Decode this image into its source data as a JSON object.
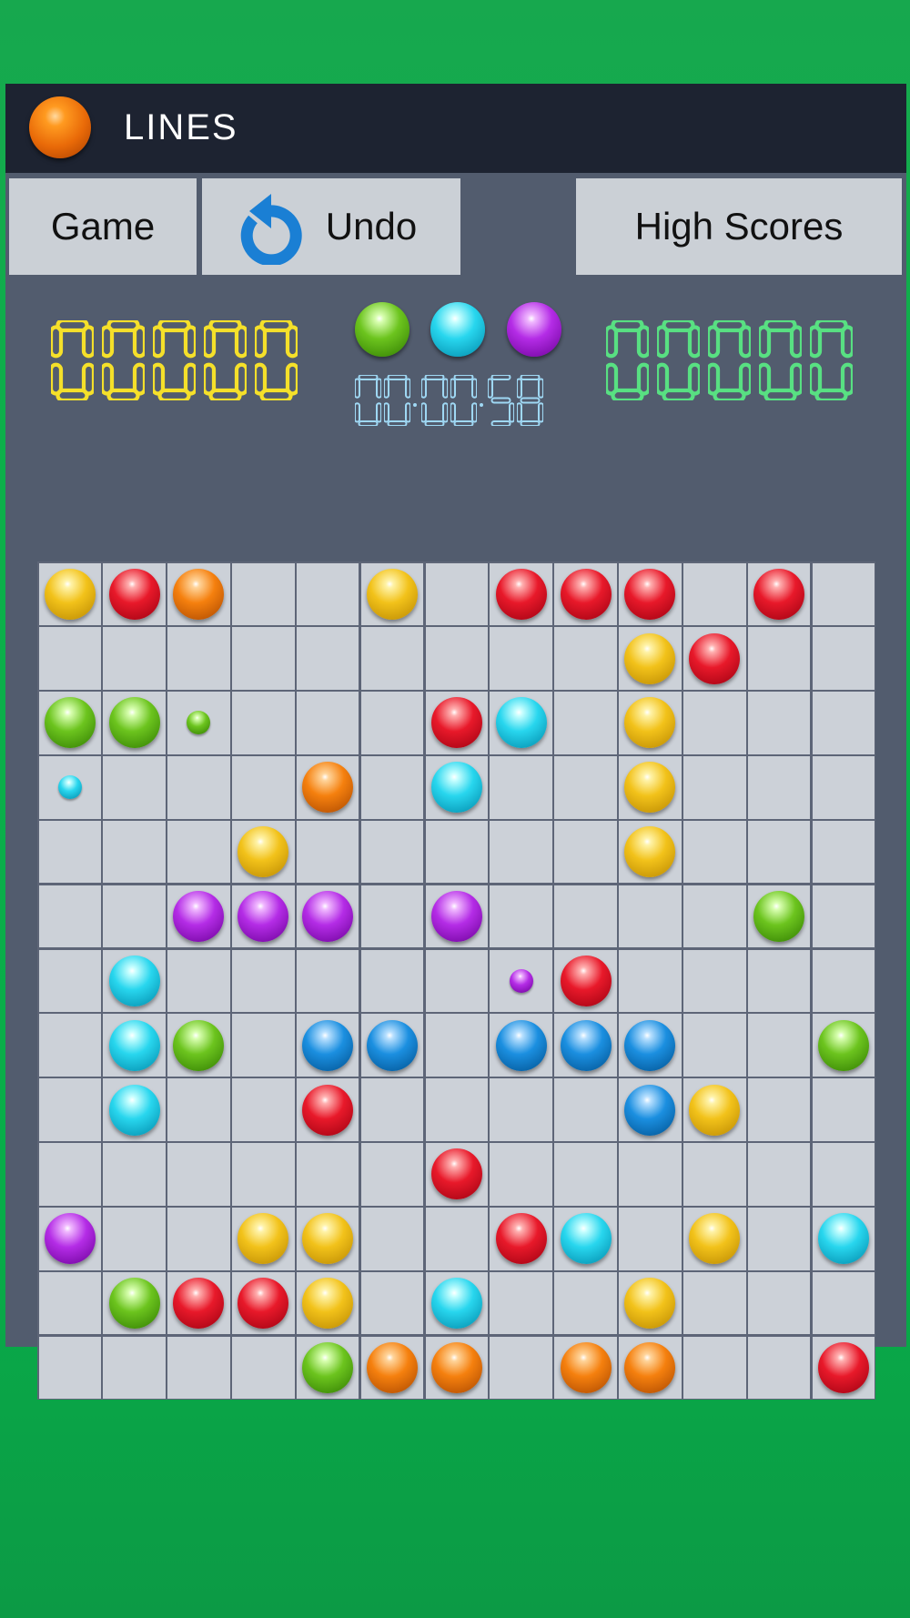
{
  "app": {
    "title": "LINES",
    "icon": "orange-ball-icon"
  },
  "toolbar": {
    "game_label": "Game",
    "undo_label": "Undo",
    "undo_icon": "undo-icon",
    "scores_label": "High Scores"
  },
  "score": {
    "current": "00000",
    "high": "00000"
  },
  "timer": "00:00:58",
  "next_balls": [
    "green",
    "cyan",
    "purple"
  ],
  "colors": {
    "yellow": [
      "#fff3a8",
      "#f2c21a",
      "#b88600"
    ],
    "red": [
      "#ffb0b0",
      "#e8192a",
      "#9b0010"
    ],
    "orange": [
      "#ffd49a",
      "#f5800e",
      "#a84600"
    ],
    "green": [
      "#d8ffb0",
      "#6cc41e",
      "#2f7a00"
    ],
    "cyan": [
      "#c8ffff",
      "#28d6ee",
      "#0088a8"
    ],
    "purple": [
      "#f0b8ff",
      "#b42ce6",
      "#6a0096"
    ],
    "blue": [
      "#b8e0ff",
      "#1b8fe0",
      "#00508e"
    ],
    "score_yellow": "#f5e02a",
    "score_green": "#58e082",
    "timer_blue": "#9fd8f4"
  },
  "board": {
    "rows": 13,
    "cols": 13,
    "balls": [
      {
        "r": 0,
        "c": 0,
        "color": "yellow"
      },
      {
        "r": 0,
        "c": 1,
        "color": "red"
      },
      {
        "r": 0,
        "c": 2,
        "color": "orange"
      },
      {
        "r": 0,
        "c": 5,
        "color": "yellow"
      },
      {
        "r": 0,
        "c": 7,
        "color": "red"
      },
      {
        "r": 0,
        "c": 8,
        "color": "red"
      },
      {
        "r": 0,
        "c": 9,
        "color": "red"
      },
      {
        "r": 0,
        "c": 11,
        "color": "red"
      },
      {
        "r": 1,
        "c": 9,
        "color": "yellow"
      },
      {
        "r": 1,
        "c": 10,
        "color": "red"
      },
      {
        "r": 2,
        "c": 0,
        "color": "green"
      },
      {
        "r": 2,
        "c": 1,
        "color": "green"
      },
      {
        "r": 2,
        "c": 2,
        "color": "green",
        "small": true
      },
      {
        "r": 2,
        "c": 6,
        "color": "red"
      },
      {
        "r": 2,
        "c": 7,
        "color": "cyan"
      },
      {
        "r": 2,
        "c": 9,
        "color": "yellow"
      },
      {
        "r": 3,
        "c": 0,
        "color": "cyan",
        "small": true
      },
      {
        "r": 3,
        "c": 4,
        "color": "orange"
      },
      {
        "r": 3,
        "c": 6,
        "color": "cyan"
      },
      {
        "r": 3,
        "c": 9,
        "color": "yellow"
      },
      {
        "r": 4,
        "c": 3,
        "color": "yellow"
      },
      {
        "r": 4,
        "c": 9,
        "color": "yellow"
      },
      {
        "r": 5,
        "c": 2,
        "color": "purple"
      },
      {
        "r": 5,
        "c": 3,
        "color": "purple"
      },
      {
        "r": 5,
        "c": 4,
        "color": "purple"
      },
      {
        "r": 5,
        "c": 6,
        "color": "purple"
      },
      {
        "r": 5,
        "c": 11,
        "color": "green"
      },
      {
        "r": 6,
        "c": 1,
        "color": "cyan"
      },
      {
        "r": 6,
        "c": 7,
        "color": "purple",
        "small": true
      },
      {
        "r": 6,
        "c": 8,
        "color": "red"
      },
      {
        "r": 7,
        "c": 1,
        "color": "cyan"
      },
      {
        "r": 7,
        "c": 2,
        "color": "green"
      },
      {
        "r": 7,
        "c": 4,
        "color": "blue"
      },
      {
        "r": 7,
        "c": 5,
        "color": "blue"
      },
      {
        "r": 7,
        "c": 7,
        "color": "blue"
      },
      {
        "r": 7,
        "c": 8,
        "color": "blue"
      },
      {
        "r": 7,
        "c": 9,
        "color": "blue"
      },
      {
        "r": 7,
        "c": 12,
        "color": "green"
      },
      {
        "r": 8,
        "c": 1,
        "color": "cyan"
      },
      {
        "r": 8,
        "c": 4,
        "color": "red"
      },
      {
        "r": 8,
        "c": 9,
        "color": "blue"
      },
      {
        "r": 8,
        "c": 10,
        "color": "yellow"
      },
      {
        "r": 9,
        "c": 6,
        "color": "red"
      },
      {
        "r": 10,
        "c": 0,
        "color": "purple"
      },
      {
        "r": 10,
        "c": 3,
        "color": "yellow"
      },
      {
        "r": 10,
        "c": 4,
        "color": "yellow"
      },
      {
        "r": 10,
        "c": 7,
        "color": "red"
      },
      {
        "r": 10,
        "c": 8,
        "color": "cyan"
      },
      {
        "r": 10,
        "c": 10,
        "color": "yellow"
      },
      {
        "r": 10,
        "c": 12,
        "color": "cyan"
      },
      {
        "r": 11,
        "c": 1,
        "color": "green"
      },
      {
        "r": 11,
        "c": 2,
        "color": "red"
      },
      {
        "r": 11,
        "c": 3,
        "color": "red"
      },
      {
        "r": 11,
        "c": 4,
        "color": "yellow"
      },
      {
        "r": 11,
        "c": 6,
        "color": "cyan"
      },
      {
        "r": 11,
        "c": 9,
        "color": "yellow"
      },
      {
        "r": 12,
        "c": 4,
        "color": "green"
      },
      {
        "r": 12,
        "c": 5,
        "color": "orange"
      },
      {
        "r": 12,
        "c": 6,
        "color": "orange"
      },
      {
        "r": 12,
        "c": 8,
        "color": "orange"
      },
      {
        "r": 12,
        "c": 9,
        "color": "orange"
      },
      {
        "r": 12,
        "c": 12,
        "color": "red"
      }
    ]
  }
}
